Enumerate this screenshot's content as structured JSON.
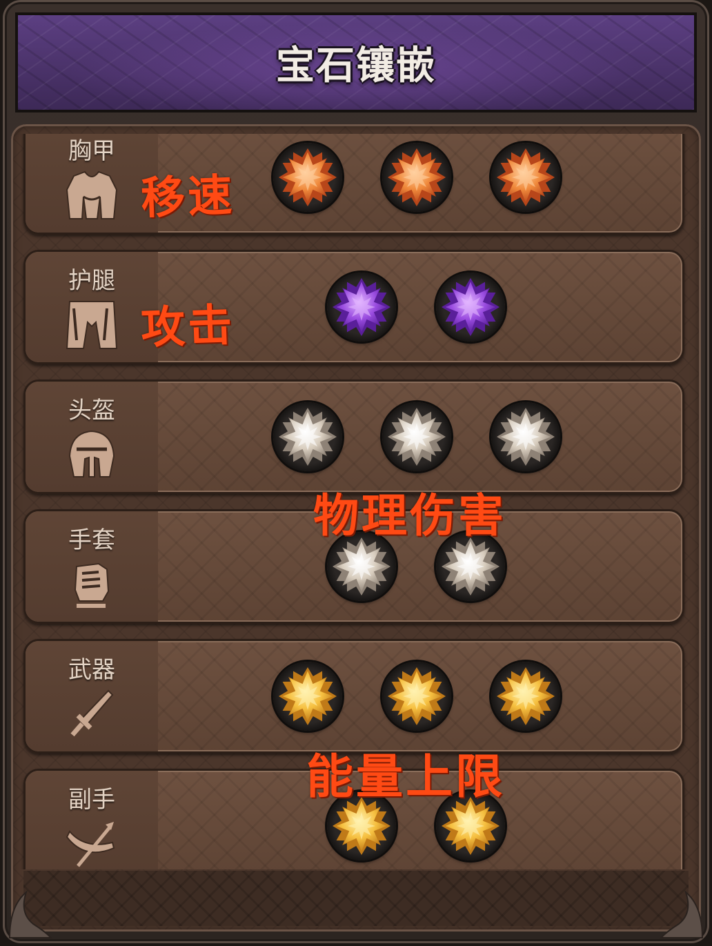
{
  "title": "宝石镶嵌",
  "rows": [
    {
      "label": "胸甲",
      "icon": "chest-armor-icon",
      "gem_color": "orange",
      "gem_count": 3
    },
    {
      "label": "护腿",
      "icon": "leg-armor-icon",
      "gem_color": "purple",
      "gem_count": 2
    },
    {
      "label": "头盔",
      "icon": "helmet-icon",
      "gem_color": "silver",
      "gem_count": 3
    },
    {
      "label": "手套",
      "icon": "gauntlet-icon",
      "gem_color": "silver",
      "gem_count": 2
    },
    {
      "label": "武器",
      "icon": "sword-icon",
      "gem_color": "gold",
      "gem_count": 3
    },
    {
      "label": "副手",
      "icon": "offhand-weapon-icon",
      "gem_color": "gold",
      "gem_count": 2
    }
  ],
  "annotations": {
    "move_speed": "移速",
    "attack": "攻击",
    "physical_damage": "物理伤害",
    "energy_cap": "能量上限"
  },
  "colors": {
    "orange_gem": "#f08a3c",
    "purple_gem": "#9a4ce0",
    "silver_gem": "#d8cdbe",
    "gold_gem": "#f6c040",
    "annotation": "#ff4a14",
    "banner": "#4a3168"
  }
}
